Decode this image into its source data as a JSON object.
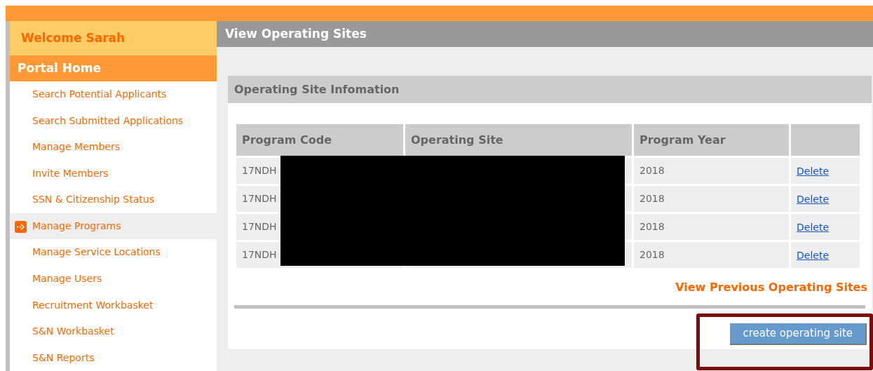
{
  "sidebar": {
    "welcome": "Welcome Sarah",
    "home": "Portal Home",
    "items": [
      {
        "label": "Search Potential Applicants",
        "selected": false
      },
      {
        "label": "Search Submitted Applications",
        "selected": false
      },
      {
        "label": "Manage Members",
        "selected": false
      },
      {
        "label": "Invite Members",
        "selected": false
      },
      {
        "label": "SSN & Citizenship Status",
        "selected": false
      },
      {
        "label": "Manage Programs",
        "selected": true
      },
      {
        "label": "Manage Service Locations",
        "selected": false
      },
      {
        "label": "Manage Users",
        "selected": false
      },
      {
        "label": "Recruitment Workbasket",
        "selected": false
      },
      {
        "label": "S&N Workbasket",
        "selected": false
      },
      {
        "label": "S&N Reports",
        "selected": false
      }
    ]
  },
  "page_title": "View Operating Sites",
  "panel": {
    "title": "Operating Site Infomation",
    "table": {
      "columns": [
        "Program Code",
        "Operating Site",
        "Program Year"
      ],
      "rows": [
        {
          "program_code": "17NDH",
          "program_year": "2018",
          "action": "Delete"
        },
        {
          "program_code": "17NDH",
          "program_year": "2018",
          "action": "Delete"
        },
        {
          "program_code": "17NDH",
          "program_year": "2018",
          "action": "Delete"
        },
        {
          "program_code": "17NDH",
          "program_year": "2018",
          "action": "Delete"
        }
      ]
    },
    "previous_link": "View Previous Operating Sites",
    "create_button": "create operating site"
  }
}
